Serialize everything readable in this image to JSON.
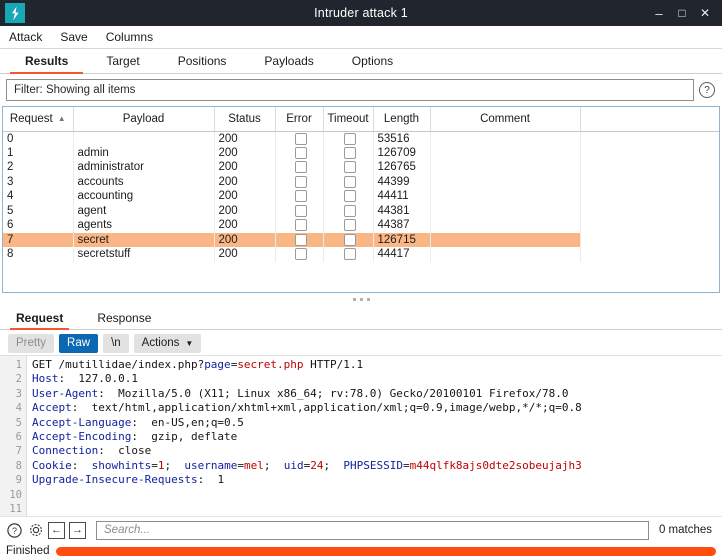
{
  "window": {
    "title": "Intruder attack 1",
    "logo_icon": "burp-lightning-icon",
    "minimize": "–",
    "maximize": "□",
    "close": "✕"
  },
  "menu": {
    "items": [
      {
        "label": "Attack"
      },
      {
        "label": "Save"
      },
      {
        "label": "Columns"
      }
    ]
  },
  "tabs": {
    "items": [
      {
        "label": "Results",
        "active": true
      },
      {
        "label": "Target",
        "active": false
      },
      {
        "label": "Positions",
        "active": false
      },
      {
        "label": "Payloads",
        "active": false
      },
      {
        "label": "Options",
        "active": false
      }
    ]
  },
  "filter": {
    "label": "Filter:  Showing all items",
    "help_icon": "question-mark-icon",
    "help_glyph": "?"
  },
  "results_table": {
    "columns": [
      {
        "label": "Request",
        "sorted": true,
        "sort_glyph": "▲"
      },
      {
        "label": "Payload"
      },
      {
        "label": "Status"
      },
      {
        "label": "Error"
      },
      {
        "label": "Timeout"
      },
      {
        "label": "Length"
      },
      {
        "label": "Comment"
      }
    ],
    "rows": [
      {
        "request": "0",
        "payload": "",
        "status": "200",
        "error": false,
        "timeout": false,
        "length": "53516",
        "comment": "",
        "selected": false
      },
      {
        "request": "1",
        "payload": "admin",
        "status": "200",
        "error": false,
        "timeout": false,
        "length": "126709",
        "comment": "",
        "selected": false
      },
      {
        "request": "2",
        "payload": "administrator",
        "status": "200",
        "error": false,
        "timeout": false,
        "length": "126765",
        "comment": "",
        "selected": false
      },
      {
        "request": "3",
        "payload": "accounts",
        "status": "200",
        "error": false,
        "timeout": false,
        "length": "44399",
        "comment": "",
        "selected": false
      },
      {
        "request": "4",
        "payload": "accounting",
        "status": "200",
        "error": false,
        "timeout": false,
        "length": "44411",
        "comment": "",
        "selected": false
      },
      {
        "request": "5",
        "payload": "agent",
        "status": "200",
        "error": false,
        "timeout": false,
        "length": "44381",
        "comment": "",
        "selected": false
      },
      {
        "request": "6",
        "payload": "agents",
        "status": "200",
        "error": false,
        "timeout": false,
        "length": "44387",
        "comment": "",
        "selected": false
      },
      {
        "request": "7",
        "payload": "secret",
        "status": "200",
        "error": false,
        "timeout": false,
        "length": "126715",
        "comment": "",
        "selected": true
      },
      {
        "request": "8",
        "payload": "secretstuff",
        "status": "200",
        "error": false,
        "timeout": false,
        "length": "44417",
        "comment": "",
        "selected": false
      }
    ]
  },
  "detail": {
    "tabs": [
      {
        "label": "Request",
        "active": true
      },
      {
        "label": "Response",
        "active": false
      }
    ],
    "toolbar": {
      "pretty": "Pretty",
      "raw": "Raw",
      "newline": "\\n",
      "actions": "Actions",
      "actions_chevron": "⌵"
    },
    "line_numbers": [
      "1",
      "2",
      "3",
      "4",
      "5",
      "6",
      "7",
      "8",
      "9",
      "10",
      "11"
    ],
    "lines": [
      {
        "n": 1,
        "segments": [
          {
            "t": "GET /mutillidae/index.php?",
            "c": "plain"
          },
          {
            "t": "page",
            "c": "key"
          },
          {
            "t": "=",
            "c": "plain"
          },
          {
            "t": "secret.php",
            "c": "val"
          },
          {
            "t": " HTTP/1.1",
            "c": "plain"
          }
        ]
      },
      {
        "n": 2,
        "segments": [
          {
            "t": "Host",
            "c": "key"
          },
          {
            "t": ":  127.0.0.1",
            "c": "plain"
          }
        ]
      },
      {
        "n": 3,
        "segments": [
          {
            "t": "User-Agent",
            "c": "key"
          },
          {
            "t": ":  Mozilla/5.0 (X11; Linux x86_64; rv:78.0) Gecko/20100101 Firefox/78.0",
            "c": "plain"
          }
        ]
      },
      {
        "n": 4,
        "segments": [
          {
            "t": "Accept",
            "c": "key"
          },
          {
            "t": ":  text/html,application/xhtml+xml,application/xml;q=0.9,image/webp,*/*;q=0.8",
            "c": "plain"
          }
        ]
      },
      {
        "n": 5,
        "segments": [
          {
            "t": "Accept-Language",
            "c": "key"
          },
          {
            "t": ":  en-US,en;q=0.5",
            "c": "plain"
          }
        ]
      },
      {
        "n": 6,
        "segments": [
          {
            "t": "Accept-Encoding",
            "c": "key"
          },
          {
            "t": ":  gzip, deflate",
            "c": "plain"
          }
        ]
      },
      {
        "n": 7,
        "segments": [
          {
            "t": "Connection",
            "c": "key"
          },
          {
            "t": ":  close",
            "c": "plain"
          }
        ]
      },
      {
        "n": 8,
        "segments": [
          {
            "t": "Cookie",
            "c": "key"
          },
          {
            "t": ":  ",
            "c": "plain"
          },
          {
            "t": "showhints",
            "c": "key"
          },
          {
            "t": "=",
            "c": "plain"
          },
          {
            "t": "1",
            "c": "val"
          },
          {
            "t": ";  ",
            "c": "plain"
          },
          {
            "t": "username",
            "c": "key"
          },
          {
            "t": "=",
            "c": "plain"
          },
          {
            "t": "mel",
            "c": "val"
          },
          {
            "t": ";  ",
            "c": "plain"
          },
          {
            "t": "uid",
            "c": "key"
          },
          {
            "t": "=",
            "c": "plain"
          },
          {
            "t": "24",
            "c": "val"
          },
          {
            "t": ";  ",
            "c": "plain"
          },
          {
            "t": "PHPSESSID",
            "c": "key"
          },
          {
            "t": "=",
            "c": "plain"
          },
          {
            "t": "m44qlfk8ajs0dte2sobeujajh3",
            "c": "val"
          }
        ]
      },
      {
        "n": 9,
        "segments": [
          {
            "t": "Upgrade-Insecure-Requests",
            "c": "key"
          },
          {
            "t": ":  1",
            "c": "plain"
          }
        ]
      },
      {
        "n": 10,
        "segments": []
      },
      {
        "n": 11,
        "segments": []
      }
    ]
  },
  "search": {
    "help_icon": "question-mark-icon",
    "help_glyph": "?",
    "settings_icon": "gear-icon",
    "back_icon": "arrow-left-icon",
    "back_glyph": "←",
    "forward_icon": "arrow-right-icon",
    "forward_glyph": "→",
    "placeholder": "Search...",
    "value": "",
    "matches": "0 matches"
  },
  "status": {
    "label": "Finished",
    "progress_percent": 100,
    "progress_color": "#ff4d0d"
  }
}
